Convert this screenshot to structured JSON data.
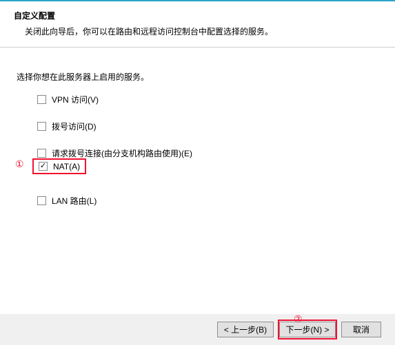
{
  "header": {
    "title": "自定义配置",
    "subtitle": "关闭此向导后，你可以在路由和远程访问控制台中配置选择的服务。"
  },
  "prompt": "选择你想在此服务器上启用的服务。",
  "options": {
    "vpn": {
      "label": "VPN 访问(V)",
      "checked": false
    },
    "dial": {
      "label": "拨号访问(D)",
      "checked": false
    },
    "demand": {
      "label": "请求拨号连接(由分支机构路由使用)(E)",
      "checked": false
    },
    "nat": {
      "label": "NAT(A)",
      "checked": true
    },
    "lan": {
      "label": "LAN 路由(L)",
      "checked": false
    }
  },
  "annotations": {
    "one": "①",
    "two": "②"
  },
  "buttons": {
    "back": "< 上一步(B)",
    "next": "下一步(N) >",
    "cancel": "取消"
  }
}
